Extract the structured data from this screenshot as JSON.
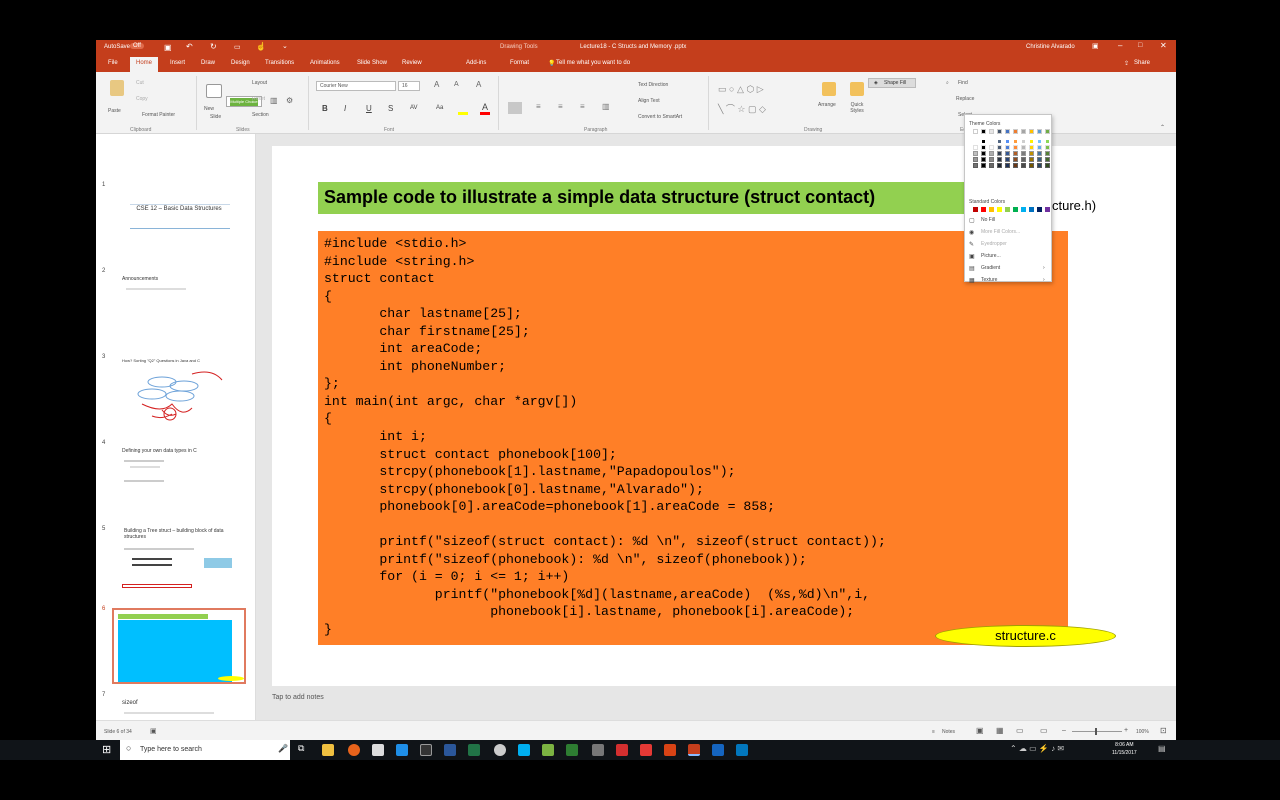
{
  "titlebar": {
    "autosave": "AutoSave",
    "autosave_state": "Off",
    "contextual_tab": "Drawing Tools",
    "document_title": "Lecture18 - C Structs and Memory .pptx",
    "user": "Christine Alvarado"
  },
  "menu": {
    "tabs": [
      "File",
      "Home",
      "Insert",
      "Draw",
      "Design",
      "Transitions",
      "Animations",
      "Slide Show",
      "Review",
      "Add-ins",
      "Format"
    ],
    "active_tab": "Home",
    "tell_me": "Tell me what you want to do",
    "share": "Share"
  },
  "ribbon": {
    "clipboard": {
      "paste": "Paste",
      "cut": "Cut",
      "copy": "Copy",
      "format_painter": "Format Painter",
      "label": "Clipboard"
    },
    "slides": {
      "new_slide": "New",
      "slide": "Slide",
      "layout": "Layout",
      "reset": "Reset",
      "section": "Section",
      "addin_label": "Multiple Choice",
      "label": "Slides"
    },
    "font": {
      "name": "Courier New",
      "size": "16",
      "bold": "B",
      "italic": "I",
      "underline": "U",
      "strike": "S",
      "spacing": "AV",
      "case": "Aa",
      "label": "Font"
    },
    "paragraph": {
      "text_direction": "Text Direction",
      "align_text": "Align Text",
      "convert_smartart": "Convert to SmartArt",
      "label": "Paragraph"
    },
    "drawing": {
      "arrange": "Arrange",
      "quick_styles": "Quick Styles",
      "shape_fill": "Shape Fill",
      "label": "Drawing"
    },
    "editing": {
      "find": "Find",
      "replace": "Replace",
      "select": "Select",
      "label": "Editing"
    }
  },
  "shape_fill_menu": {
    "theme_colors_label": "Theme Colors",
    "standard_colors_label": "Standard Colors",
    "items": [
      "No Fill",
      "More Fill Colors...",
      "Eyedropper",
      "Picture...",
      "Gradient",
      "Texture"
    ],
    "theme_colors": [
      "#ffffff",
      "#000000",
      "#e7e6e6",
      "#44546a",
      "#4472c4",
      "#ed7d31",
      "#a5a5a5",
      "#ffc000",
      "#5b9bd5",
      "#70ad47"
    ],
    "standard_colors": [
      "#c00000",
      "#ff0000",
      "#ffc000",
      "#ffff00",
      "#92d050",
      "#00b050",
      "#00b0f0",
      "#0070c0",
      "#002060",
      "#7030a0"
    ]
  },
  "thumbnails": [
    {
      "num": "1",
      "title": "CSE 12 – Basic Data Structures"
    },
    {
      "num": "2",
      "title": "Announcements"
    },
    {
      "num": "3",
      "title": "How? Sorting \"Q2\" Questions in Java and C"
    },
    {
      "num": "4",
      "title": "Defining your own data types in C"
    },
    {
      "num": "5",
      "title": "Building a Tree struct – building block of data structures"
    },
    {
      "num": "6",
      "title": "Sample code to illustrate a simple data structure"
    },
    {
      "num": "7",
      "title": "sizeof"
    }
  ],
  "slide": {
    "title": "Sample code to illustrate a simple data structure (struct contact)",
    "header_file": "(structure.h)",
    "source_file": "structure.c",
    "code_lines": [
      "#include <stdio.h>",
      "#include <string.h>",
      "struct contact",
      "{",
      "       char lastname[25];",
      "       char firstname[25];",
      "       int areaCode;",
      "       int phoneNumber;",
      "};",
      "int main(int argc, char *argv[])",
      "{",
      "       int i;",
      "       struct contact phonebook[100];",
      "       strcpy(phonebook[1].lastname,\"Papadopoulos\");",
      "       strcpy(phonebook[0].lastname,\"Alvarado\");",
      "       phonebook[0].areaCode=phonebook[1].areaCode = 858;",
      "",
      "       printf(\"sizeof(struct contact): %d \\n\", sizeof(struct contact));",
      "       printf(\"sizeof(phonebook): %d \\n\", sizeof(phonebook));",
      "       for (i = 0; i <= 1; i++)",
      "              printf(\"phonebook[%d](lastname,areaCode)  (%s,%d)\\n\",i,",
      "                     phonebook[i].lastname, phonebook[i].areaCode);",
      "}"
    ]
  },
  "notes_placeholder": "Tap to add notes",
  "status": {
    "slide_counter": "Slide 6 of 34",
    "notes": "Notes",
    "zoom": "100%"
  },
  "taskbar": {
    "search_placeholder": "Type here to search",
    "time": "8:06 AM",
    "date": "11/15/2017"
  }
}
